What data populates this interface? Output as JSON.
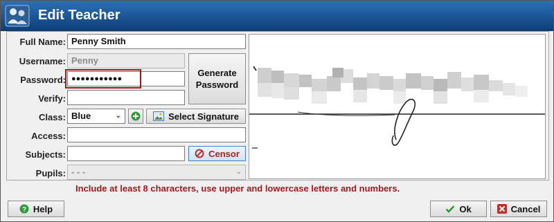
{
  "window": {
    "title": "Edit Teacher"
  },
  "form": {
    "full_name_label": "Full Name:",
    "full_name_value": "Penny Smith",
    "username_label": "Username:",
    "username_value": "Penny",
    "password_label": "Password:",
    "password_value": "●●●●●●●●●●●",
    "verify_label": "Verify:",
    "verify_value": "",
    "class_label": "Class:",
    "class_value": "Blue",
    "access_label": "Access:",
    "access_value": "",
    "subjects_label": "Subjects:",
    "subjects_value": "",
    "pupils_label": "Pupils:",
    "pupils_value": "- - -"
  },
  "buttons": {
    "generate_password_line1": "Generate",
    "generate_password_line2": "Password",
    "add_class": "+",
    "select_signature": "Select Signature",
    "censor": "Censor",
    "help": "Help",
    "ok": "Ok",
    "cancel": "Cancel"
  },
  "message": "Include at least 8 characters, use upper and lowercase letters and numbers.",
  "colors": {
    "title_bar": "#1d5a9c",
    "error_text": "#a11a1a",
    "highlight": "#a01818",
    "help_icon": "#2e9a3a",
    "ok_check": "#2e9a3a",
    "cancel_x": "#c0302a",
    "censor_icon": "#c0302a"
  }
}
